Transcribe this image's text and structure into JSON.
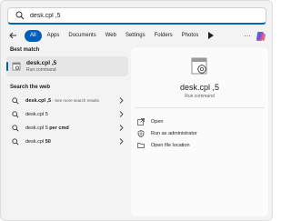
{
  "search": {
    "query": "desk.cpl ,5"
  },
  "filters": {
    "tabs": [
      {
        "label": "All",
        "active": true
      },
      {
        "label": "Apps"
      },
      {
        "label": "Documents"
      },
      {
        "label": "Web"
      },
      {
        "label": "Settings"
      },
      {
        "label": "Folders"
      },
      {
        "label": "Photos"
      }
    ],
    "more_label": "···"
  },
  "best_match": {
    "heading": "Best match",
    "name": "desk.cpl ,5",
    "type": "Run command"
  },
  "web": {
    "heading": "Search the web",
    "items": [
      {
        "text": "desk.cpl ,5",
        "hint": " - See more search results"
      },
      {
        "text": "desk.cpl 5",
        "hint": ""
      },
      {
        "text_plain": "desk.cpl 5 ",
        "text_bold": "per cmd"
      },
      {
        "text_plain": "desk.cpl ",
        "text_bold": "50"
      }
    ]
  },
  "detail": {
    "title": "desk.cpl ,5",
    "subtitle": "Run command",
    "actions": [
      {
        "label": "Open",
        "icon": "open-icon"
      },
      {
        "label": "Run as administrator",
        "icon": "shield-icon"
      },
      {
        "label": "Open file location",
        "icon": "folder-icon"
      }
    ]
  },
  "colors": {
    "accent": "#005fb8",
    "panel": "#f3f3f3",
    "detail": "#fbfbfb"
  }
}
